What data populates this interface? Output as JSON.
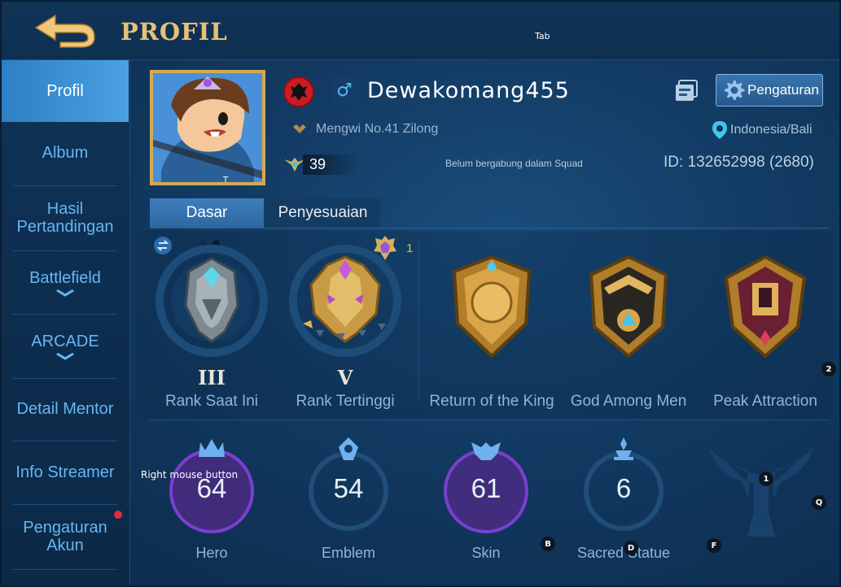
{
  "header": {
    "title": "PROFIL",
    "back_icon": "back-arrow-icon"
  },
  "overlay_hints": {
    "tab": "Tab",
    "right_mouse": "Right mouse button",
    "badge_2": "2",
    "badge_1": "1",
    "badge_q": "Q",
    "badge_b": "B",
    "badge_d": "D",
    "badge_f": "F",
    "avatar_t": "T"
  },
  "sidebar": {
    "items": [
      {
        "label": "Profil"
      },
      {
        "label": "Album"
      },
      {
        "label": "Hasil Pertandingan"
      },
      {
        "label": "Battlefield"
      },
      {
        "label": "ARCADE"
      },
      {
        "label": "Detail Mentor"
      },
      {
        "label": "Info Streamer"
      },
      {
        "label": "Pengaturan Akun"
      }
    ]
  },
  "profile": {
    "username": "Dewakomang455",
    "gender_symbol": "♂",
    "title": "Mengwi No.41 Zilong",
    "level": "39",
    "squad_status": "Belum bergabung dalam Squad",
    "location": "Indonesia/Bali",
    "id_label": "ID:",
    "id_value": "132652998",
    "id_zone": "(2680)",
    "settings_label": "Pengaturan"
  },
  "tabs": {
    "basic": "Dasar",
    "custom": "Penyesuaian"
  },
  "ranks": {
    "highest_badge_count": "1",
    "current": {
      "roman": "III",
      "label": "Rank Saat Ini"
    },
    "highest": {
      "roman": "V",
      "label": "Rank Tertinggi"
    },
    "achievements": [
      {
        "label": "Return of the King"
      },
      {
        "label": "God Among Men"
      },
      {
        "label": "Peak Attraction"
      }
    ]
  },
  "stats": [
    {
      "value": "64",
      "label": "Hero"
    },
    {
      "value": "54",
      "label": "Emblem"
    },
    {
      "value": "61",
      "label": "Skin"
    },
    {
      "value": "6",
      "label": "Sacred Statue"
    }
  ],
  "colors": {
    "title_gold": "#e7c079",
    "sidebar_active": "#4aa1e2",
    "sidebar_text": "#66b6f2",
    "accent_blue": "#2e7fc3"
  }
}
